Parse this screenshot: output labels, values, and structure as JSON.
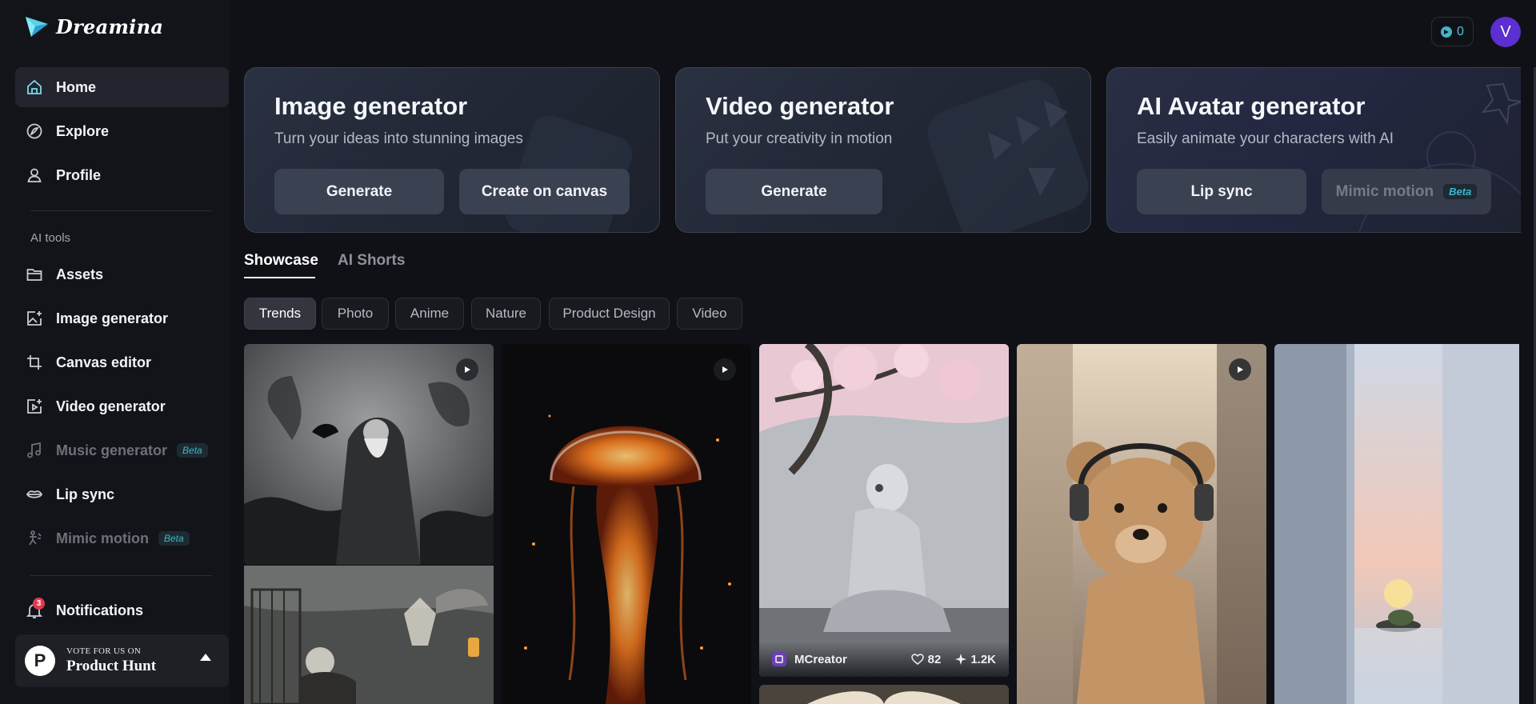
{
  "brand": {
    "name": "Dreamina"
  },
  "sidebar": {
    "primary": [
      {
        "label": "Home",
        "icon": "home-icon"
      },
      {
        "label": "Explore",
        "icon": "compass-icon"
      },
      {
        "label": "Profile",
        "icon": "user-icon"
      }
    ],
    "section_title": "AI tools",
    "tools": [
      {
        "label": "Assets",
        "icon": "folder-icon"
      },
      {
        "label": "Image generator",
        "icon": "image-plus-icon"
      },
      {
        "label": "Canvas editor",
        "icon": "crop-icon"
      },
      {
        "label": "Video generator",
        "icon": "video-plus-icon"
      },
      {
        "label": "Music generator",
        "icon": "music-icon",
        "badge": "Beta"
      },
      {
        "label": "Lip sync",
        "icon": "lip-sync-icon"
      },
      {
        "label": "Mimic motion",
        "icon": "motion-icon",
        "badge": "Beta"
      }
    ],
    "notifications": {
      "label": "Notifications",
      "count": "3"
    },
    "product_hunt": {
      "small": "VOTE FOR US ON",
      "big": "Product Hunt",
      "logo_letter": "P"
    }
  },
  "header": {
    "credits": "0",
    "avatar_letter": "V"
  },
  "features": [
    {
      "title": "Image generator",
      "subtitle": "Turn your ideas into stunning images",
      "buttons": [
        "Generate",
        "Create on canvas"
      ]
    },
    {
      "title": "Video generator",
      "subtitle": "Put your creativity in motion",
      "buttons": [
        "Generate"
      ]
    },
    {
      "title": "AI Avatar generator",
      "subtitle": "Easily animate your characters with AI",
      "buttons": [
        "Lip sync",
        "Mimic motion"
      ],
      "badge": "Beta"
    }
  ],
  "tabs": [
    "Showcase",
    "AI Shorts"
  ],
  "chips": [
    "Trends",
    "Photo",
    "Anime",
    "Nature",
    "Product Design",
    "Video"
  ],
  "gallery": {
    "card3": {
      "creator": "MCreator",
      "likes": "82",
      "uses": "1.2K"
    }
  },
  "colors": {
    "background": "#101116",
    "accent": "#3fb6c9",
    "avatar": "#5b2fd0",
    "notification": "#e5384f"
  }
}
